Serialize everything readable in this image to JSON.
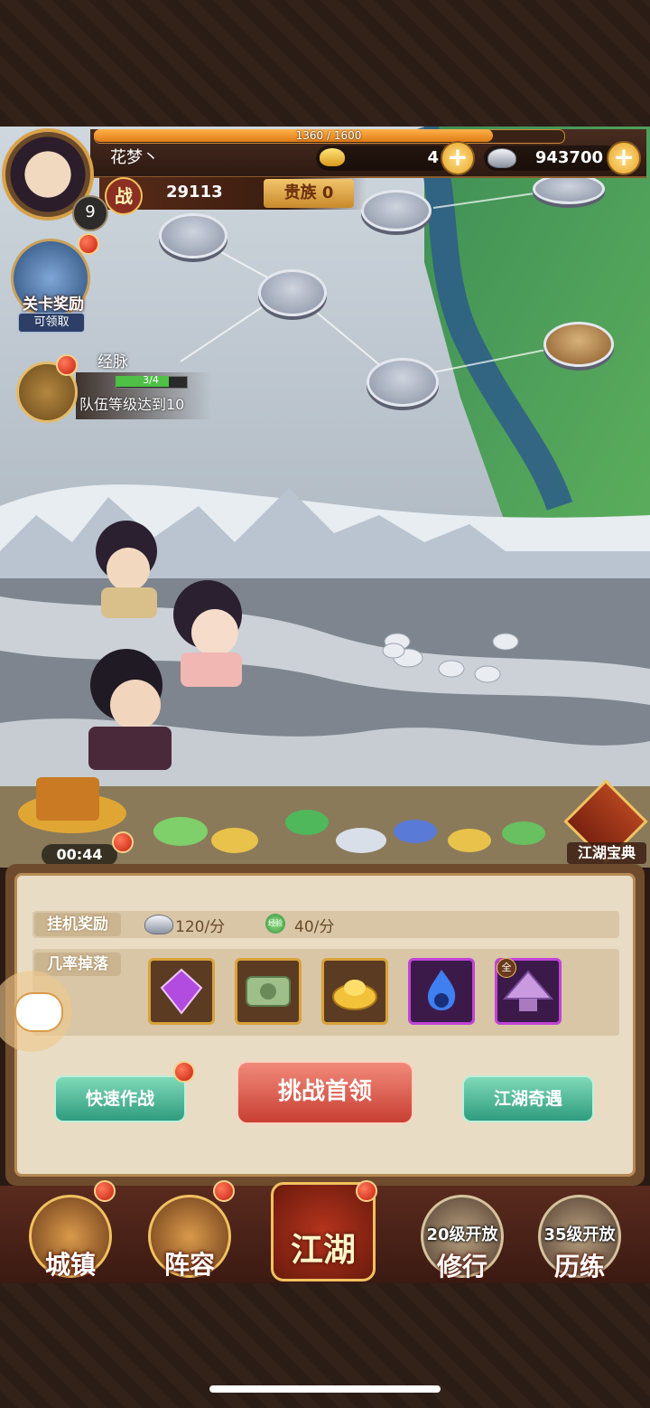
{
  "player": {
    "name": "花梦丶",
    "level": "9",
    "exp_text": "1360 / 1600",
    "exp_fraction": 0.85,
    "power_icon": "战",
    "power": "29113",
    "noble": "贵族 0"
  },
  "currency": {
    "gold": "4",
    "silver": "943700"
  },
  "left_panel": {
    "stage_reward_label": "关卡奖励",
    "stage_reward_sub": "可领取",
    "meridian_label": "经脉",
    "task_progress": "3/4",
    "task_progress_fraction": 0.75,
    "task_text": "队伍等级达到10"
  },
  "battle": {
    "timer": "00:44",
    "treasure_label": "江湖宝典"
  },
  "idle_panel": {
    "reward_tag": "挂机奖励",
    "silver_rate": "120/分",
    "exp_icon": "经验",
    "exp_rate": "40/分",
    "drop_tag": "几率掉落",
    "drops": [
      "purple-gem-icon",
      "scroll-icon",
      "gold-ingot-icon",
      "blue-flame-icon",
      "purple-hat-icon"
    ],
    "drop_badge": "全"
  },
  "actions": {
    "quick_battle": "快速作战",
    "challenge_boss": "挑战首领",
    "encounter": "江湖奇遇"
  },
  "nav": {
    "town": "城镇",
    "lineup": "阵容",
    "jianghu": "江湖",
    "practice_lock": "20级开放",
    "practice": "修行",
    "training_lock": "35级开放",
    "training": "历练"
  },
  "colors": {
    "frame": "#2b1c16",
    "accent_gold": "#f1c160",
    "red_button": "#c83f33",
    "green_button": "#2f9c7f"
  }
}
